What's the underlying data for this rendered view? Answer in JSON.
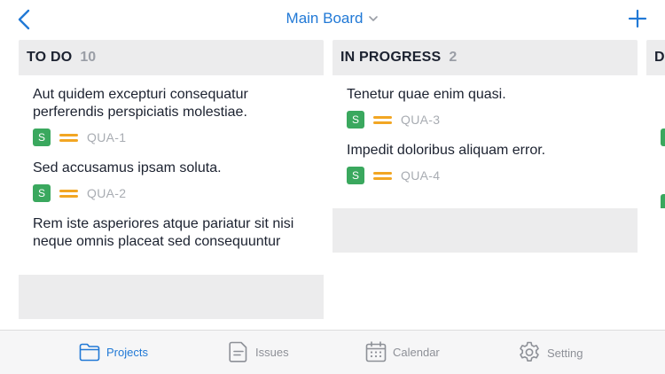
{
  "header": {
    "title": "Main Board",
    "back_icon": "chevron-left-icon",
    "add_icon": "plus-icon"
  },
  "columns": [
    {
      "title": "TO DO",
      "count": "10",
      "cards": [
        {
          "title": "Aut quidem excepturi consequatur perferendis perspiciatis molestiae.",
          "badge": "S",
          "key": "QUA-1"
        },
        {
          "title": "Sed accusamus ipsam soluta.",
          "badge": "S",
          "key": "QUA-2"
        },
        {
          "title": "Rem iste asperiores atque pariatur sit nisi neque omnis placeat sed consequuntur"
        }
      ]
    },
    {
      "title": "IN PROGRESS",
      "count": "2",
      "cards": [
        {
          "title": "Tenetur quae enim quasi.",
          "badge": "S",
          "key": "QUA-3"
        },
        {
          "title": "Impedit doloribus aliquam error.",
          "badge": "S",
          "key": "QUA-4"
        }
      ]
    },
    {
      "title": "D"
    }
  ],
  "tabs": [
    {
      "label": "Projects",
      "icon": "folder-icon",
      "active": true
    },
    {
      "label": "Issues",
      "icon": "issues-icon",
      "active": false
    },
    {
      "label": "Calendar",
      "icon": "calendar-icon",
      "active": false
    },
    {
      "label": "Setting",
      "icon": "gear-icon",
      "active": false
    }
  ],
  "colors": {
    "accent": "#2179d6",
    "badge_green": "#3aa85e",
    "priority_orange": "#f2a623",
    "column_header_bg": "#ececed"
  }
}
